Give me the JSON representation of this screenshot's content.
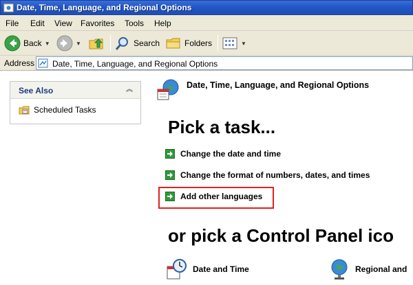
{
  "window": {
    "title": "Date, Time, Language, and Regional Options"
  },
  "menu": [
    "File",
    "Edit",
    "View",
    "Favorites",
    "Tools",
    "Help"
  ],
  "toolbar": {
    "back": "Back",
    "search": "Search",
    "folders": "Folders"
  },
  "address": {
    "label": "Address",
    "value": "Date, Time, Language, and Regional Options"
  },
  "see_also": {
    "title": "See Also",
    "items": [
      {
        "label": "Scheduled Tasks",
        "icon": "scheduled-tasks-icon"
      }
    ]
  },
  "main": {
    "heading": "Date, Time, Language, and Regional Options",
    "pick_task_title": "Pick a task...",
    "tasks": [
      {
        "label": "Change the date and time"
      },
      {
        "label": "Change the format of numbers, dates, and times"
      },
      {
        "label": "Add other languages",
        "highlighted": true
      }
    ],
    "pick_icon_title": "or pick a Control Panel ico",
    "icons": [
      {
        "label": "Date and Time",
        "icon": "clock-icon"
      },
      {
        "label": "Regional and",
        "icon": "globe-icon"
      }
    ]
  },
  "colors": {
    "titlebar": "#2156c7",
    "highlight_border": "#e02020",
    "task_arrow": "#2e9a3a"
  }
}
